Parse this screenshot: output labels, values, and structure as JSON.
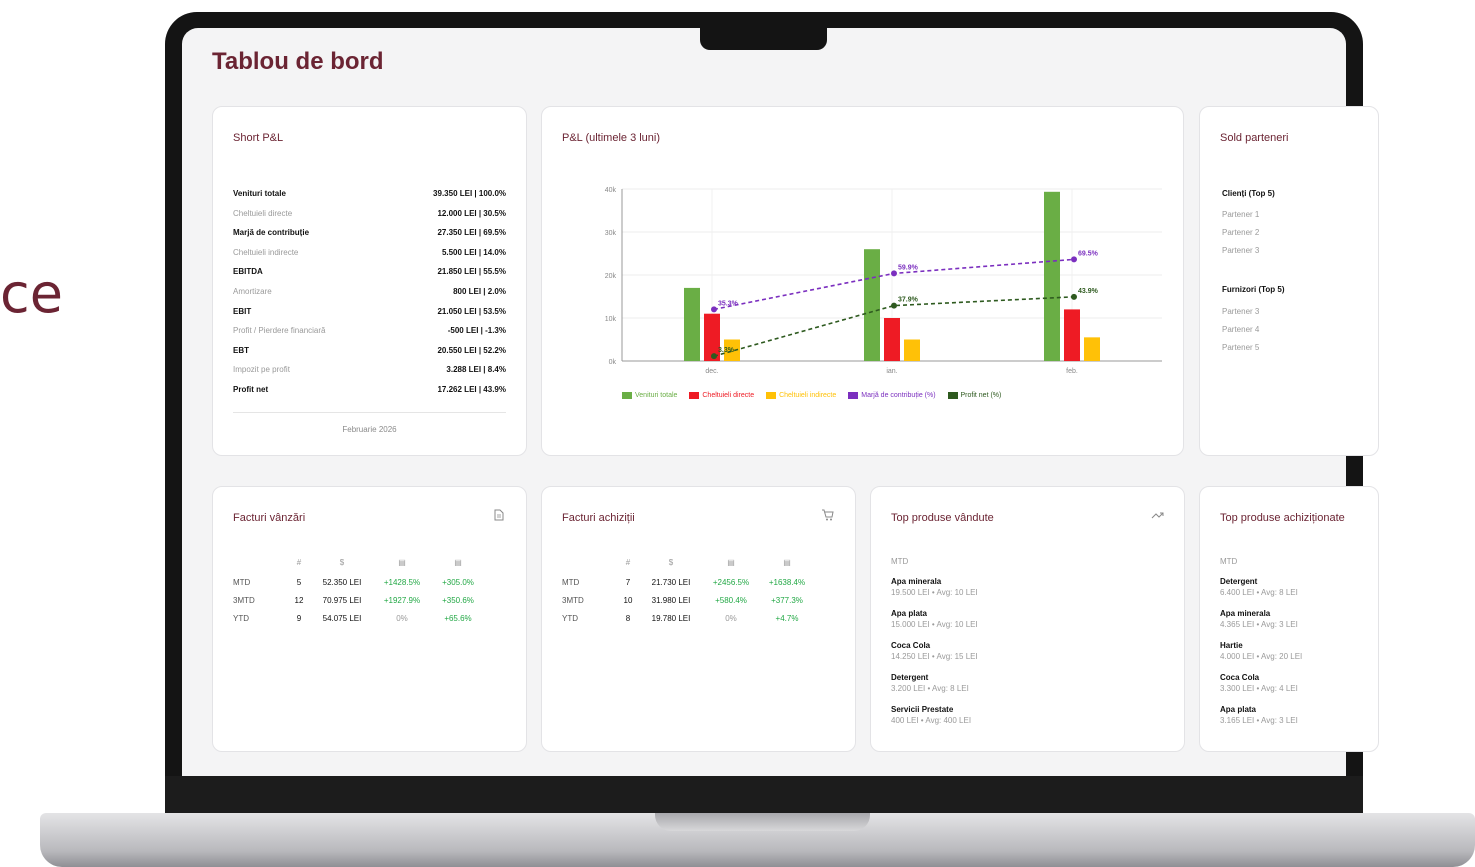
{
  "side_fragment": "ce",
  "dashboard": {
    "title": "Tablou de bord"
  },
  "short_pl": {
    "title": "Short P&L",
    "period": "Februarie 2026",
    "rows": [
      {
        "label": "Venituri totale",
        "value": "39.350 LEI | 100.0%"
      },
      {
        "label": "Cheltuieli directe",
        "value": "12.000 LEI | 30.5%"
      },
      {
        "label": "Marjă de contribuție",
        "value": "27.350 LEI | 69.5%"
      },
      {
        "label": "Cheltuieli indirecte",
        "value": "5.500 LEI | 14.0%"
      },
      {
        "label": "EBITDA",
        "value": "21.850 LEI | 55.5%"
      },
      {
        "label": "Amortizare",
        "value": "800 LEI | 2.0%"
      },
      {
        "label": "EBIT",
        "value": "21.050 LEI | 53.5%"
      },
      {
        "label": "Profit / Pierdere financiară",
        "value": "-500 LEI | -1.3%"
      },
      {
        "label": "EBT",
        "value": "20.550 LEI | 52.2%"
      },
      {
        "label": "Impozit pe profit",
        "value": "3.288 LEI | 8.4%"
      },
      {
        "label": "Profit net",
        "value": "17.262 LEI | 43.9%"
      }
    ]
  },
  "pl_chart": {
    "title": "P&L (ultimele 3 luni)",
    "legend": [
      "Venituri totale",
      "Cheltuieli directe",
      "Cheltuieli indirecte",
      "Marjă de contribuție (%)",
      "Profit net (%)"
    ]
  },
  "chart_data": {
    "type": "bar",
    "categories": [
      "dec.",
      "ian.",
      "feb."
    ],
    "ylim": [
      0,
      40000
    ],
    "yticks": [
      "0k",
      "10k",
      "20k",
      "30k",
      "40k"
    ],
    "series": [
      {
        "name": "Venituri totale",
        "kind": "bar",
        "color": "#6aae45",
        "values": [
          17000,
          26000,
          39350
        ]
      },
      {
        "name": "Cheltuieli directe",
        "kind": "bar",
        "color": "#ee1b24",
        "values": [
          11000,
          10000,
          12000
        ]
      },
      {
        "name": "Cheltuieli indirecte",
        "kind": "bar",
        "color": "#ffc107",
        "values": [
          5000,
          5000,
          5500
        ]
      },
      {
        "name": "Marjă de contribuție (%)",
        "kind": "line",
        "color": "#7b2fbf",
        "percent": [
          35.3,
          59.9,
          69.5
        ],
        "labels": [
          "35.3%",
          "59.9%",
          "69.5%"
        ]
      },
      {
        "name": "Profit net (%)",
        "kind": "line",
        "color": "#2e5a1f",
        "percent": [
          3.3,
          37.9,
          43.9
        ],
        "labels": [
          "3.3%",
          "37.9%",
          "43.9%"
        ]
      }
    ],
    "grid": true,
    "legend_position": "bottom"
  },
  "partners": {
    "title": "Sold parteneri",
    "clients_title": "Clienți (Top 5)",
    "clients": [
      "Partener 1",
      "Partener 2",
      "Partener 3"
    ],
    "suppliers_title": "Furnizori (Top 5)",
    "suppliers": [
      "Partener 3",
      "Partener 4",
      "Partener 5"
    ]
  },
  "sales_invoices": {
    "title": "Facturi vânzări",
    "icon": "document-icon",
    "headers": [
      "",
      "#",
      "$",
      "▤",
      "▤"
    ],
    "rows": [
      [
        "MTD",
        "5",
        "52.350 LEI",
        "+1428.5%",
        "+305.0%"
      ],
      [
        "3MTD",
        "12",
        "70.975 LEI",
        "+1927.9%",
        "+350.6%"
      ],
      [
        "YTD",
        "9",
        "54.075 LEI",
        "0%",
        "+65.6%"
      ]
    ]
  },
  "purchase_invoices": {
    "title": "Facturi achiziții",
    "icon": "cart-icon",
    "headers": [
      "",
      "#",
      "$",
      "▤",
      "▤"
    ],
    "rows": [
      [
        "MTD",
        "7",
        "21.730 LEI",
        "+2456.5%",
        "+1638.4%"
      ],
      [
        "3MTD",
        "10",
        "31.980 LEI",
        "+580.4%",
        "+377.3%"
      ],
      [
        "YTD",
        "8",
        "19.780 LEI",
        "0%",
        "+4.7%"
      ]
    ]
  },
  "top_sold": {
    "title": "Top produse vândute",
    "icon": "trend-up-icon",
    "period": "MTD",
    "items": [
      {
        "name": "Apa minerala",
        "meta": "19.500 LEI • Avg: 10 LEI"
      },
      {
        "name": "Apa plata",
        "meta": "15.000 LEI • Avg: 10 LEI"
      },
      {
        "name": "Coca Cola",
        "meta": "14.250 LEI • Avg: 15 LEI"
      },
      {
        "name": "Detergent",
        "meta": "3.200 LEI • Avg: 8 LEI"
      },
      {
        "name": "Servicii Prestate",
        "meta": "400 LEI • Avg: 400 LEI"
      }
    ]
  },
  "top_bought": {
    "title": "Top produse achiziționate",
    "period": "MTD",
    "items": [
      {
        "name": "Detergent",
        "meta": "6.400 LEI • Avg: 8 LEI"
      },
      {
        "name": "Apa minerala",
        "meta": "4.365 LEI • Avg: 3 LEI"
      },
      {
        "name": "Hartie",
        "meta": "4.000 LEI • Avg: 20 LEI"
      },
      {
        "name": "Coca Cola",
        "meta": "3.300 LEI • Avg: 4 LEI"
      },
      {
        "name": "Apa plata",
        "meta": "3.165 LEI • Avg: 3 LEI"
      }
    ]
  }
}
